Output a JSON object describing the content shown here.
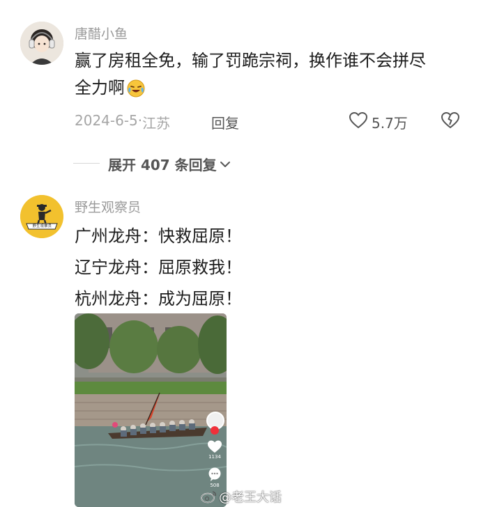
{
  "comments": [
    {
      "username": "唐醋小鱼",
      "text_line1": "赢了房租全免，输了罚跪宗祠，换作谁不会拼尽",
      "text_line2": "全力啊",
      "emoji": "laughing-crying-emoji",
      "date": "2024-6-5",
      "location_sep": "·",
      "location": "江苏",
      "reply_label": "回复",
      "likes": "5.7万",
      "expand_label": "展开 407 条回复"
    },
    {
      "username": "野生观察员",
      "lines": [
        "广州龙舟：快救屈原！",
        "辽宁龙舟：屈原救我！",
        "杭州龙舟：成为屈原！"
      ],
      "avatar_text": "野 生 观 察 员",
      "video": {
        "like_count": "1134",
        "comment_count": "508"
      }
    }
  ],
  "watermark": {
    "icon": "weibo-icon",
    "text": "@老王大话"
  },
  "colors": {
    "avatar2_bg": "#f2c12e",
    "meta_text": "#a5a5a5",
    "body_text": "#1c1c1c"
  }
}
